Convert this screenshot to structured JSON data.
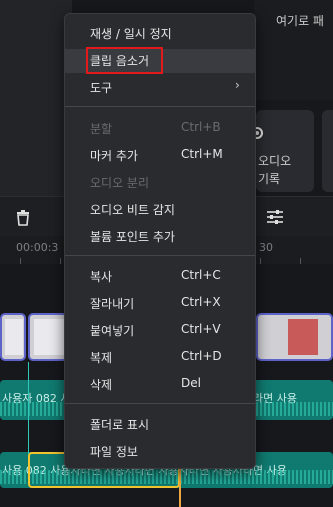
{
  "preview": {
    "hint": "여기로 패"
  },
  "card": {
    "line1": "오디오",
    "line2": "기록"
  },
  "timeline": {
    "ruler_left": "00:00:3",
    "ruler_right": "30"
  },
  "tracks": {
    "audio1_text": "사용자  082  사용자라면 사용자라면 사용자라면 사용자라면 사용",
    "audio2_text": "사용  082  사용자라면 사용자라면 사용자라면 사용자라면 사용"
  },
  "menu": {
    "items": [
      {
        "label": "재생 / 일시 정지",
        "key": ""
      },
      {
        "label": "클립 음소거",
        "key": ""
      },
      {
        "label": "도구",
        "key": ""
      },
      {
        "label": "분할",
        "key": "Ctrl+B"
      },
      {
        "label": "마커 추가",
        "key": "Ctrl+M"
      },
      {
        "label": "오디오 분리",
        "key": ""
      },
      {
        "label": "오디오 비트 감지",
        "key": ""
      },
      {
        "label": "볼륨 포인트 추가",
        "key": ""
      },
      {
        "label": "복사",
        "key": "Ctrl+C"
      },
      {
        "label": "잘라내기",
        "key": "Ctrl+X"
      },
      {
        "label": "붙여넣기",
        "key": "Ctrl+V"
      },
      {
        "label": "복제",
        "key": "Ctrl+D"
      },
      {
        "label": "삭제",
        "key": "Del"
      },
      {
        "label": "폴더로 표시",
        "key": ""
      },
      {
        "label": "파일 정보",
        "key": ""
      }
    ],
    "submenu_arrow": "›"
  },
  "icons": {
    "trash": "trash-icon",
    "adjust": "adjust-icon"
  },
  "colors": {
    "menu_bg": "#2a2b2f",
    "highlight_border": "#e01a1a",
    "playhead": "#f0a640",
    "audio_track": "#107a70",
    "selection": "#f2c530"
  }
}
